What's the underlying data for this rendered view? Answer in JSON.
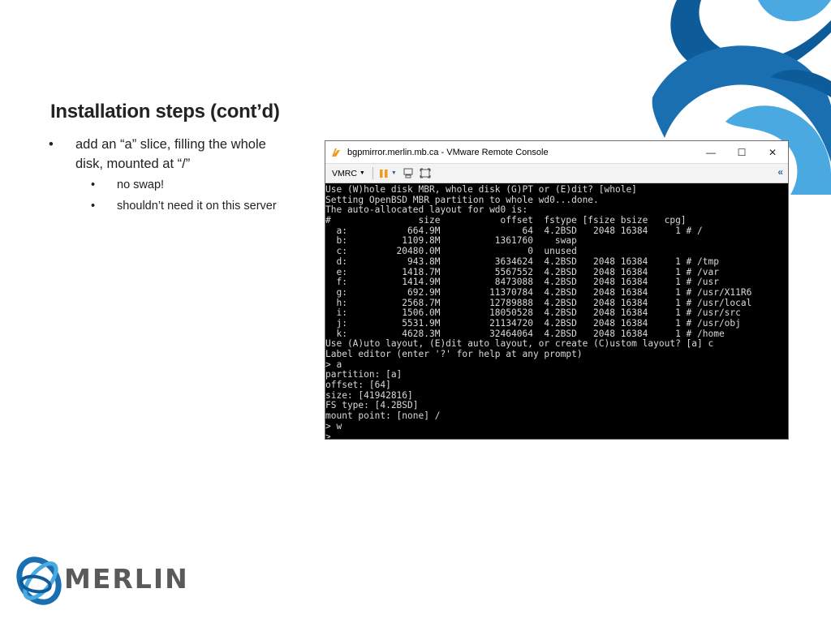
{
  "slide": {
    "title": "Installation steps (cont’d)",
    "bullet_main_line1": "add an “a” slice, filling the whole",
    "bullet_main_line2": "disk, mounted at “/”",
    "sub_bullets": [
      "no swap!",
      "shouldn’t need it on this server"
    ],
    "bullet_glyph": "•"
  },
  "window": {
    "title": "bgpmirror.merlin.mb.ca - VMware Remote Console",
    "minimize_glyph": "—",
    "maximize_glyph": "☐",
    "close_glyph": "✕"
  },
  "toolbar": {
    "menu_label": "VMRC",
    "expand_glyph": "«"
  },
  "console": {
    "lines": [
      "Use (W)hole disk MBR, whole disk (G)PT or (E)dit? [whole]",
      "Setting OpenBSD MBR partition to whole wd0...done.",
      "The auto-allocated layout for wd0 is:",
      "#                size           offset  fstype [fsize bsize   cpg]",
      "  a:           664.9M               64  4.2BSD   2048 16384     1 # /",
      "  b:          1109.8M          1361760    swap",
      "  c:         20480.0M                0  unused",
      "  d:           943.8M          3634624  4.2BSD   2048 16384     1 # /tmp",
      "  e:          1418.7M          5567552  4.2BSD   2048 16384     1 # /var",
      "  f:          1414.9M          8473088  4.2BSD   2048 16384     1 # /usr",
      "  g:           692.9M         11370784  4.2BSD   2048 16384     1 # /usr/X11R6",
      "  h:          2568.7M         12789888  4.2BSD   2048 16384     1 # /usr/local",
      "  i:          1506.0M         18050528  4.2BSD   2048 16384     1 # /usr/src",
      "  j:          5531.9M         21134720  4.2BSD   2048 16384     1 # /usr/obj",
      "  k:          4628.3M         32464064  4.2BSD   2048 16384     1 # /home",
      "Use (A)uto layout, (E)dit auto layout, or create (C)ustom layout? [a] c",
      "Label editor (enter '?' for help at any prompt)",
      "> a",
      "partition: [a]",
      "offset: [64]",
      "size: [41942816]",
      "FS type: [4.2BSD]",
      "mount point: [none] /",
      "> w",
      "> _"
    ]
  },
  "logo": {
    "text": "MERLIN"
  }
}
